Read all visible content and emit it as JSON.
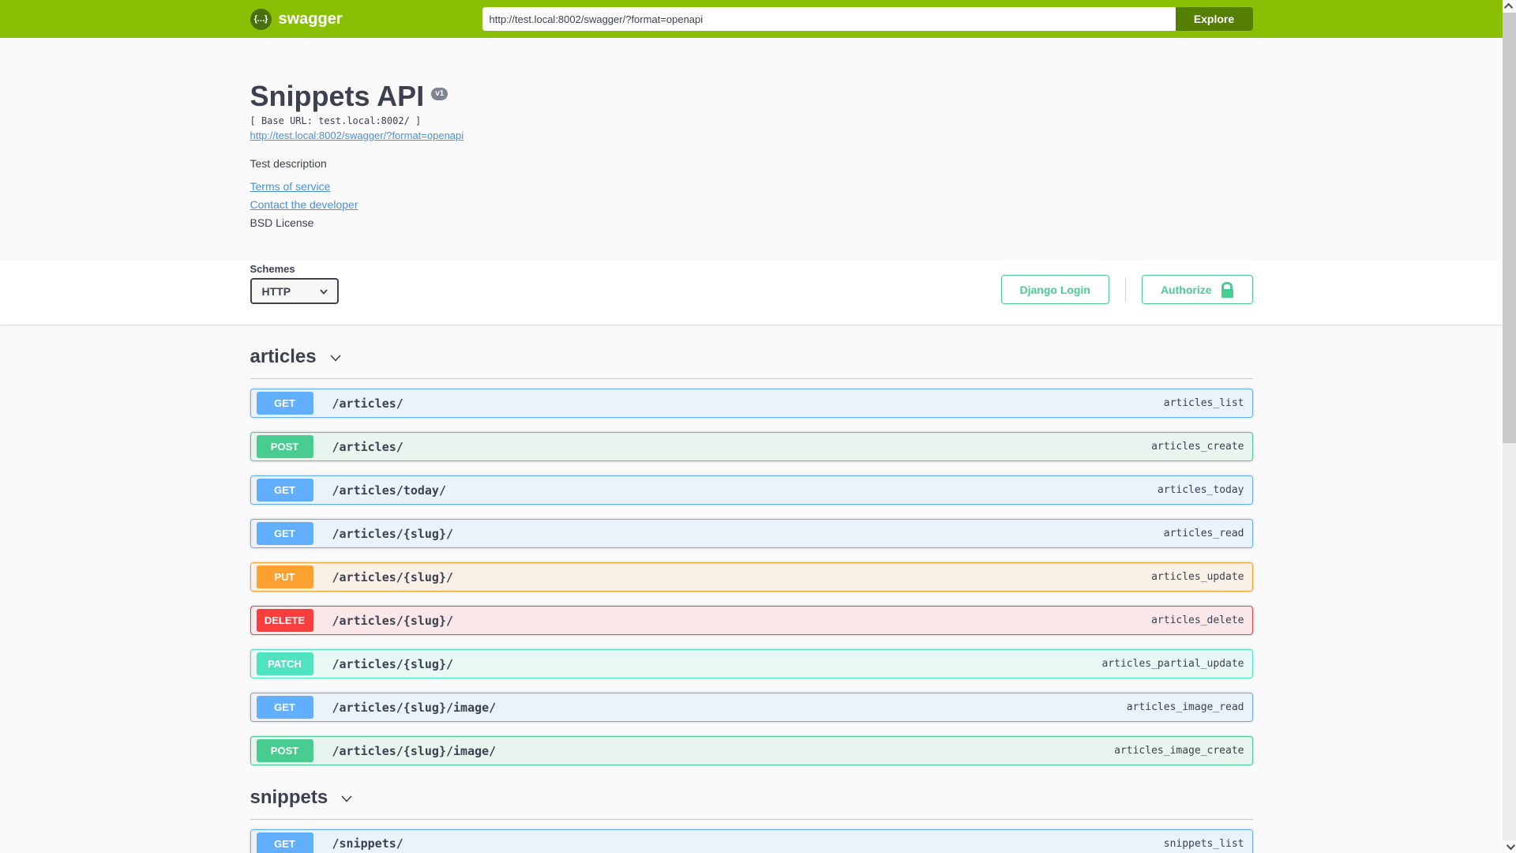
{
  "topbar": {
    "brand": "swagger",
    "logo_glyph": "{…}",
    "url_value": "http://test.local:8002/swagger/?format=openapi",
    "explore_label": "Explore"
  },
  "info": {
    "title": "Snippets API",
    "version_badge": "v1",
    "base_url": "[ Base URL: test.local:8002/ ]",
    "spec_link": "http://test.local:8002/swagger/?format=openapi",
    "description": "Test description",
    "terms_link": "Terms of service",
    "contact_link": "Contact the developer",
    "license": "BSD License"
  },
  "schemes": {
    "label": "Schemes",
    "selected": "HTTP"
  },
  "auth": {
    "django_login_label": "Django Login",
    "authorize_label": "Authorize"
  },
  "sections": [
    {
      "name": "articles",
      "operations": [
        {
          "method": "GET",
          "path": "/articles/",
          "op_id": "articles_list"
        },
        {
          "method": "POST",
          "path": "/articles/",
          "op_id": "articles_create"
        },
        {
          "method": "GET",
          "path": "/articles/today/",
          "op_id": "articles_today"
        },
        {
          "method": "GET",
          "path": "/articles/{slug}/",
          "op_id": "articles_read"
        },
        {
          "method": "PUT",
          "path": "/articles/{slug}/",
          "op_id": "articles_update"
        },
        {
          "method": "DELETE",
          "path": "/articles/{slug}/",
          "op_id": "articles_delete"
        },
        {
          "method": "PATCH",
          "path": "/articles/{slug}/",
          "op_id": "articles_partial_update"
        },
        {
          "method": "GET",
          "path": "/articles/{slug}/image/",
          "op_id": "articles_image_read"
        },
        {
          "method": "POST",
          "path": "/articles/{slug}/image/",
          "op_id": "articles_image_create"
        }
      ]
    },
    {
      "name": "snippets",
      "operations": [
        {
          "method": "GET",
          "path": "/snippets/",
          "op_id": "snippets_list"
        }
      ]
    }
  ],
  "colors": {
    "topbar_green": "#89bf04",
    "explore_green": "#547f00",
    "accent_green": "#49cc90",
    "link_blue": "#4990e2",
    "text": "#3b4151",
    "methods": {
      "GET": {
        "badge": "#61affe",
        "tint": "#ebf2fa"
      },
      "POST": {
        "badge": "#49cc90",
        "tint": "#e8f5ef"
      },
      "PUT": {
        "badge": "#fca130",
        "tint": "#faf1e6"
      },
      "DELETE": {
        "badge": "#f93e3e",
        "tint": "#fae7e7"
      },
      "PATCH": {
        "badge": "#50e3c2",
        "tint": "#e9f8f4"
      }
    }
  }
}
